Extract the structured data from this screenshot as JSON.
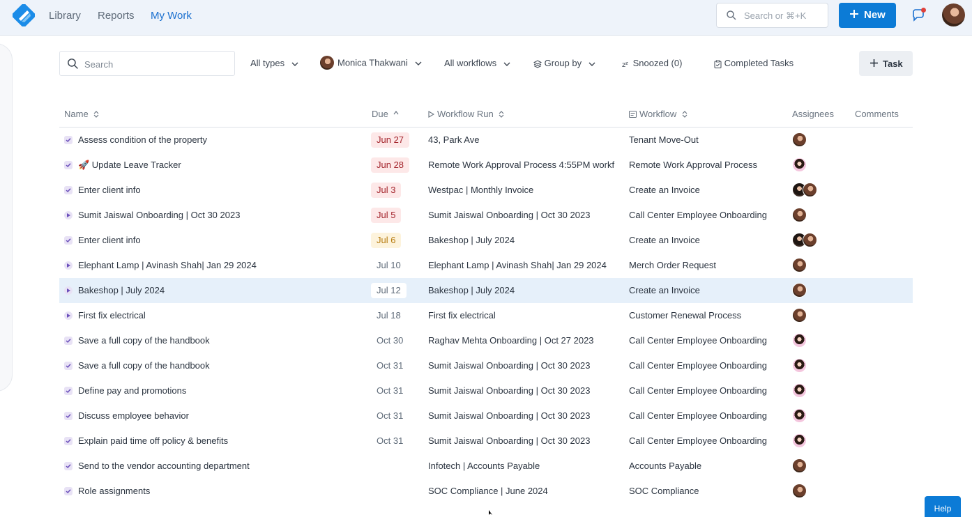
{
  "nav": {
    "links": [
      "Library",
      "Reports",
      "My Work"
    ],
    "search_placeholder": "Search or ⌘+K",
    "new_label": "New"
  },
  "filters": {
    "search_placeholder": "Search",
    "types": "All types",
    "person": "Monica Thakwani",
    "workflows": "All workflows",
    "group_by": "Group by",
    "snoozed": "Snoozed (0)",
    "completed": "Completed Tasks",
    "task_button": "Task"
  },
  "table": {
    "headers": {
      "name": "Name",
      "due": "Due",
      "run": "Workflow Run",
      "workflow": "Workflow",
      "assignees": "Assignees",
      "comments": "Comments"
    },
    "rows": [
      {
        "kind": "task",
        "name": "Assess condition of the property",
        "due": "Jun 27",
        "due_state": "overdue",
        "run": "43, Park Ave",
        "workflow": "Tenant Move-Out",
        "assignees": [
          "m"
        ]
      },
      {
        "kind": "task",
        "name": "🚀 Update Leave Tracker",
        "due": "Jun 28",
        "due_state": "overdue",
        "run": "Remote Work Approval Process 4:55PM workf",
        "workflow": "Remote Work Approval Process",
        "assignees": [
          "g"
        ]
      },
      {
        "kind": "task",
        "name": "Enter client info",
        "due": "Jul 3",
        "due_state": "overdue",
        "run": "Westpac | Monthly Invoice",
        "workflow": "Create an Invoice",
        "assignees": [
          "d",
          "m"
        ]
      },
      {
        "kind": "run",
        "name": "Sumit Jaiswal Onboarding | Oct 30 2023",
        "due": "Jul 5",
        "due_state": "overdue",
        "run": "Sumit Jaiswal Onboarding | Oct 30 2023",
        "workflow": "Call Center Employee Onboarding",
        "assignees": [
          "m"
        ]
      },
      {
        "kind": "task",
        "name": "Enter client info",
        "due": "Jul 6",
        "due_state": "warn",
        "run": "Bakeshop | July 2024",
        "workflow": "Create an Invoice",
        "assignees": [
          "d",
          "m"
        ]
      },
      {
        "kind": "run",
        "name": "Elephant Lamp | Avinash Shah| Jan 29 2024",
        "due": "Jul 10",
        "due_state": "normal",
        "run": "Elephant Lamp | Avinash Shah| Jan 29 2024",
        "workflow": "Merch Order Request",
        "assignees": [
          "m"
        ]
      },
      {
        "kind": "run",
        "name": "Bakeshop | July 2024",
        "due": "Jul 12",
        "due_state": "selected",
        "run": "Bakeshop | July 2024",
        "workflow": "Create an Invoice",
        "assignees": [
          "m"
        ],
        "selected": true
      },
      {
        "kind": "run",
        "name": "First fix electrical",
        "due": "Jul 18",
        "due_state": "normal",
        "run": "First fix electrical",
        "workflow": "Customer Renewal Process",
        "assignees": [
          "m"
        ]
      },
      {
        "kind": "task",
        "name": "Save a full copy of the handbook",
        "due": "Oct 30",
        "due_state": "normal",
        "run": "Raghav Mehta Onboarding | Oct 27 2023",
        "workflow": "Call Center Employee Onboarding",
        "assignees": [
          "g"
        ]
      },
      {
        "kind": "task",
        "name": "Save a full copy of the handbook",
        "due": "Oct 31",
        "due_state": "normal",
        "run": "Sumit Jaiswal Onboarding | Oct 30 2023",
        "workflow": "Call Center Employee Onboarding",
        "assignees": [
          "g"
        ]
      },
      {
        "kind": "task",
        "name": "Define pay and promotions",
        "due": "Oct 31",
        "due_state": "normal",
        "run": "Sumit Jaiswal Onboarding | Oct 30 2023",
        "workflow": "Call Center Employee Onboarding",
        "assignees": [
          "g"
        ]
      },
      {
        "kind": "task",
        "name": "Discuss employee behavior",
        "due": "Oct 31",
        "due_state": "normal",
        "run": "Sumit Jaiswal Onboarding | Oct 30 2023",
        "workflow": "Call Center Employee Onboarding",
        "assignees": [
          "g"
        ]
      },
      {
        "kind": "task",
        "name": "Explain paid time off policy & benefits",
        "due": "Oct 31",
        "due_state": "normal",
        "run": "Sumit Jaiswal Onboarding | Oct 30 2023",
        "workflow": "Call Center Employee Onboarding",
        "assignees": [
          "g"
        ]
      },
      {
        "kind": "task",
        "name": "Send to the vendor accounting department",
        "due": "",
        "due_state": "none",
        "run": "Infotech | Accounts Payable",
        "workflow": "Accounts Payable",
        "assignees": [
          "m"
        ]
      },
      {
        "kind": "task",
        "name": "Role assignments",
        "due": "",
        "due_state": "none",
        "run": "SOC Compliance | June 2024",
        "workflow": "SOC Compliance",
        "assignees": [
          "m"
        ]
      }
    ]
  },
  "help_label": "Help"
}
